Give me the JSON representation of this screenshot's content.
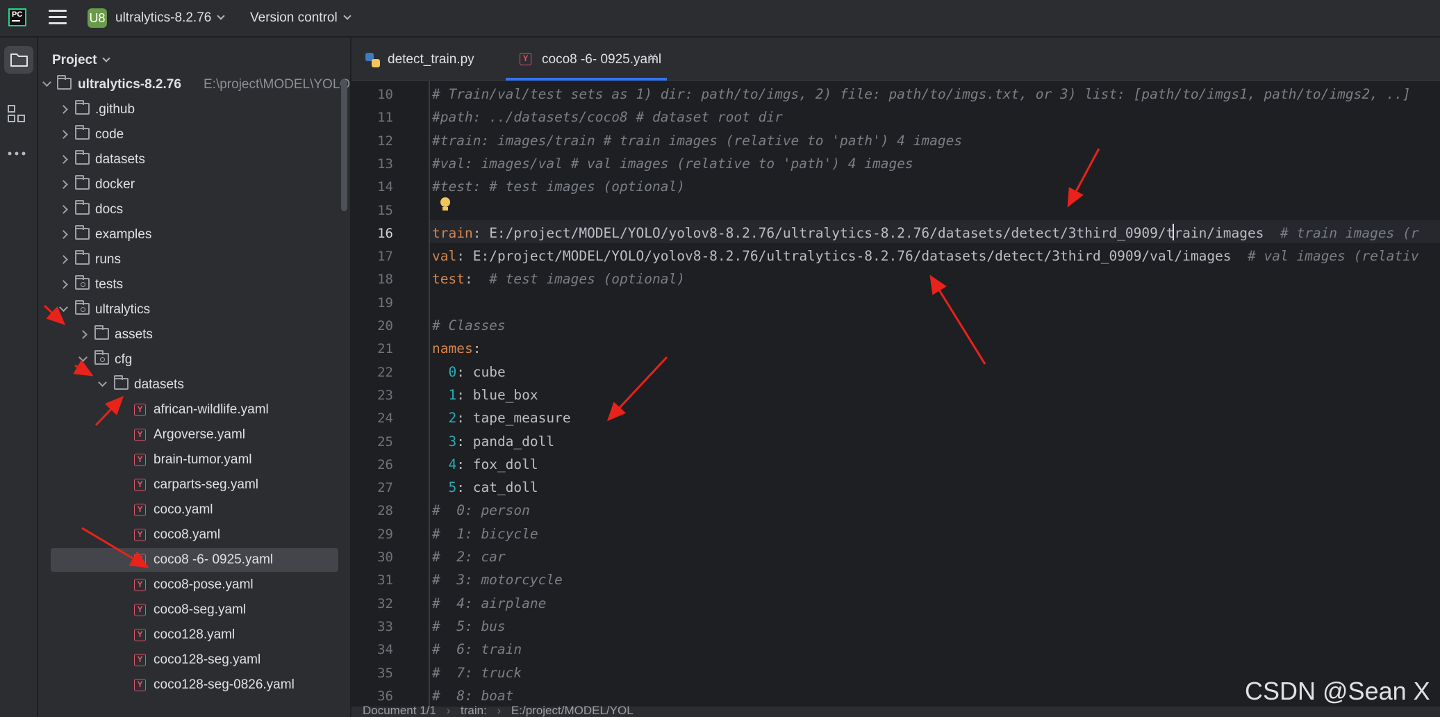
{
  "titlebar": {
    "project_badge": "U8",
    "project_name": "ultralytics-8.2.76",
    "vcs_label": "Version control"
  },
  "project_panel": {
    "title": "Project",
    "root": {
      "name": "ultralytics-8.2.76",
      "path_hint": "E:\\project\\MODEL\\YOLO"
    },
    "items": [
      {
        "label": ".github"
      },
      {
        "label": "code"
      },
      {
        "label": "datasets"
      },
      {
        "label": "docker"
      },
      {
        "label": "docs"
      },
      {
        "label": "examples"
      },
      {
        "label": "runs"
      },
      {
        "label": "tests"
      },
      {
        "label": "ultralytics"
      },
      {
        "label": "assets"
      },
      {
        "label": "cfg"
      },
      {
        "label": "datasets"
      },
      {
        "label": "african-wildlife.yaml"
      },
      {
        "label": "Argoverse.yaml"
      },
      {
        "label": "brain-tumor.yaml"
      },
      {
        "label": "carparts-seg.yaml"
      },
      {
        "label": "coco.yaml"
      },
      {
        "label": "coco8.yaml"
      },
      {
        "label": "coco8 -6- 0925.yaml"
      },
      {
        "label": "coco8-pose.yaml"
      },
      {
        "label": "coco8-seg.yaml"
      },
      {
        "label": "coco128.yaml"
      },
      {
        "label": "coco128-seg.yaml"
      },
      {
        "label": "coco128-seg-0826.yaml"
      }
    ]
  },
  "tabs": [
    {
      "label": "detect_train.py"
    },
    {
      "label": "coco8 -6- 0925.yaml"
    }
  ],
  "editor": {
    "lines": [
      {
        "num": "10",
        "text": "# Train/val/test sets as 1) dir: path/to/imgs, 2) file: path/to/imgs.txt, or 3) list: [path/to/imgs1, path/to/imgs2, ..]"
      },
      {
        "num": "11",
        "text": "#path: ../datasets/coco8 # dataset root dir"
      },
      {
        "num": "12",
        "text": "#train: images/train # train images (relative to 'path') 4 images"
      },
      {
        "num": "13",
        "text": "#val: images/val # val images (relative to 'path') 4 images"
      },
      {
        "num": "14",
        "text": "#test: # test images (optional)"
      },
      {
        "num": "15",
        "text": ""
      },
      {
        "num": "16",
        "key": "train",
        "value": "E:/project/MODEL/YOLO/yolov8-8.2.76/ultralytics-8.2.76/datasets/detect/3third_0909/train/images",
        "comment": "# train images (r"
      },
      {
        "num": "17",
        "key": "val",
        "value": "E:/project/MODEL/YOLO/yolov8-8.2.76/ultralytics-8.2.76/datasets/detect/3third_0909/val/images",
        "comment": "# val images (relativ"
      },
      {
        "num": "18",
        "key": "test",
        "value": "",
        "comment": "# test images (optional)"
      },
      {
        "num": "19",
        "text": ""
      },
      {
        "num": "20",
        "text": "# Classes"
      },
      {
        "num": "21",
        "key": "names",
        "value": "",
        "comment": ""
      },
      {
        "num": "22",
        "idx": "0",
        "cls": "cube"
      },
      {
        "num": "23",
        "idx": "1",
        "cls": "blue_box"
      },
      {
        "num": "24",
        "idx": "2",
        "cls": "tape_measure"
      },
      {
        "num": "25",
        "idx": "3",
        "cls": "panda_doll"
      },
      {
        "num": "26",
        "idx": "4",
        "cls": "fox_doll"
      },
      {
        "num": "27",
        "idx": "5",
        "cls": "cat_doll"
      },
      {
        "num": "28",
        "text": "#  0: person"
      },
      {
        "num": "29",
        "text": "#  1: bicycle"
      },
      {
        "num": "30",
        "text": "#  2: car"
      },
      {
        "num": "31",
        "text": "#  3: motorcycle"
      },
      {
        "num": "32",
        "text": "#  4: airplane"
      },
      {
        "num": "33",
        "text": "#  5: bus"
      },
      {
        "num": "34",
        "text": "#  6: train"
      },
      {
        "num": "35",
        "text": "#  7: truck"
      },
      {
        "num": "36",
        "text": "#  8: boat"
      }
    ]
  },
  "statusbar": {
    "doc": "Document 1/1",
    "crumb1": "train:",
    "crumb2": "E:/project/MODEL/YOL"
  },
  "watermark": "CSDN @Sean X",
  "colors": {
    "accent": "#3574f0",
    "yaml_icon": "#e0566b",
    "annotation_arrow": "#e8231b"
  }
}
